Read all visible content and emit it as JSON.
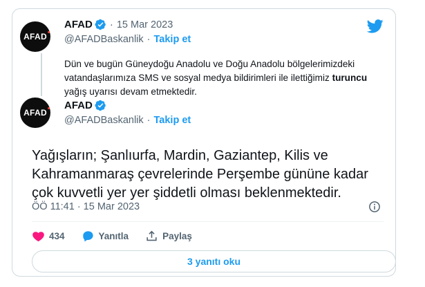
{
  "quoted": {
    "avatar_text": "AFAD",
    "name": "AFAD",
    "date": "15 Mar 2023",
    "handle": "@AFADBaskanlik",
    "follow_label": "Takip et",
    "text_before": "Dün ve bugün Güneydoğu Anadolu ve Doğu Anadolu bölgelerimizdeki vatandaşlarımıza SMS ve sosyal medya bildirimleri ile ilettiğimiz ",
    "text_bold": "turuncu",
    "text_after": " yağış uyarısı devam etmektedir."
  },
  "tweet": {
    "avatar_text": "AFAD",
    "name": "AFAD",
    "handle": "@AFADBaskanlik",
    "follow_label": "Takip et",
    "text": "Yağışların; Şanlıurfa, Mardin, Gaziantep, Kilis ve Kahramanmaraş çevrelerinde Perşembe gününe kadar çok kuvvetli yer yer şiddetli olması beklenmektedir.",
    "time": "ÖÖ 11:41 · 15 Mar 2023"
  },
  "actions": {
    "like_count": "434",
    "reply_label": "Yanıtla",
    "share_label": "Paylaş"
  },
  "read_replies_label": "3 yanıtı oku",
  "colors": {
    "accent": "#1d9bf0",
    "like": "#f91880",
    "text_secondary": "#536471"
  }
}
